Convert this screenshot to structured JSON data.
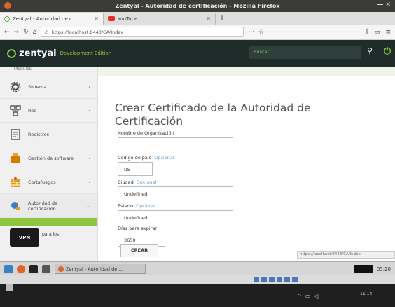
{
  "window": {
    "title": "Zentyal - Autoridad de certificación - Mozilla Firefox"
  },
  "tabs": [
    {
      "label": "Zentyal - Autoridad de c",
      "active": true
    },
    {
      "label": "YouTube",
      "active": false
    }
  ],
  "navbar": {
    "url": "https://localhost:8443/CA/Index"
  },
  "header": {
    "logo": "zentyal",
    "edition": "Development Edition",
    "search_placeholder": "Buscar..."
  },
  "sidebar": {
    "top_label": "Módulos",
    "items": [
      {
        "label": "Sistema",
        "icon": "gear-icon"
      },
      {
        "label": "Red",
        "icon": "network-icon"
      },
      {
        "label": "Registros",
        "icon": "logs-icon"
      },
      {
        "label": "Gestión de software",
        "icon": "software-icon"
      },
      {
        "label": "Cortafuegos",
        "icon": "firewall-icon"
      },
      {
        "label": "Autoridad de certificación",
        "icon": "certificate-icon"
      }
    ],
    "sub_item": "para los"
  },
  "main": {
    "title": "Crear Certificado de la Autoridad de Certificación",
    "fields": [
      {
        "label": "Nombre de Organización",
        "optional": "",
        "value": ""
      },
      {
        "label": "Código de país",
        "optional": "Opcional",
        "value": "US"
      },
      {
        "label": "Ciudad",
        "optional": "Opcional",
        "value": "Undefined"
      },
      {
        "label": "Estado",
        "optional": "Opcional",
        "value": "Undefined"
      },
      {
        "label": "Días para expirar",
        "optional": "",
        "value": "3650"
      }
    ],
    "submit_label": "CREAR"
  },
  "status_url": "https://localhost:8443/CA/Index",
  "vpn": {
    "label": "VPN"
  },
  "taskbar": {
    "task_label": "Zentyal - Autoridad de ...",
    "clock": "05:20"
  },
  "host": {
    "clock": "11:14"
  }
}
